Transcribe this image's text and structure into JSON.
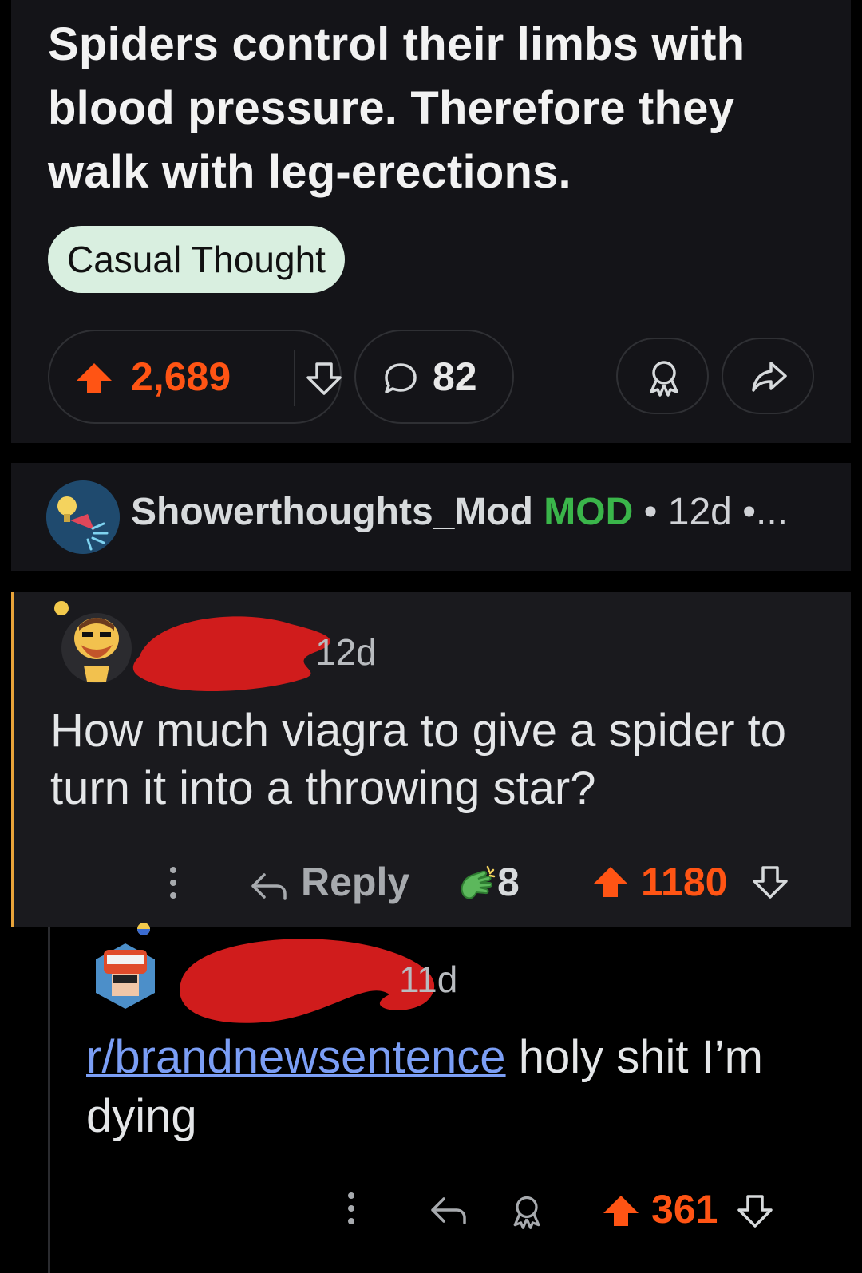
{
  "post": {
    "title": "Spiders control their limbs with blood pressure. Therefore they walk with leg-erections.",
    "flair": "Casual Thought",
    "score": "2,689",
    "comment_count": "82"
  },
  "mod_comment": {
    "username": "Showerthoughts_Mod",
    "tag": "MOD",
    "separator": "•",
    "age": "12d",
    "more": "•..."
  },
  "comment1": {
    "age": "12d",
    "body": "How much viagra to give a spider to turn it into a throwing star?",
    "reply_label": "Reply",
    "award_count": "8",
    "score": "1180"
  },
  "comment2": {
    "age": "11d",
    "link_text": "r/brandnewsentence",
    "body_rest": " holy shit I’m dying",
    "score": "361"
  },
  "colors": {
    "upvote": "#ff5414",
    "mod_tag": "#3ab54a",
    "link": "#7b9ef5",
    "thread_accent": "#e8a33a"
  }
}
